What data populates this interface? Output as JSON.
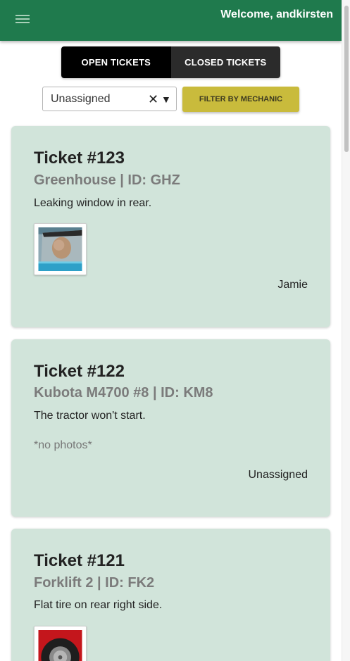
{
  "header": {
    "menu_icon": "hamburger-menu-icon",
    "welcome": "Welcome, andkirsten"
  },
  "tabs": {
    "open": "OPEN TICKETS",
    "closed": "CLOSED TICKETS",
    "active": "open"
  },
  "filter": {
    "mechanic_value": "Unassigned",
    "clear_icon": "close-icon",
    "caret_icon": "caret-down-icon",
    "button_label": "FILTER BY MECHANIC"
  },
  "tickets": [
    {
      "title": "Ticket #123",
      "subtitle": "Greenhouse | ID: GHZ",
      "description": "Leaking window in rear.",
      "photo": "broken-window-photo",
      "assignee": "Jamie"
    },
    {
      "title": "Ticket #122",
      "subtitle": "Kubota M4700 #8 | ID: KM8",
      "description": "The tractor won't start.",
      "no_photos": "*no photos*",
      "assignee": "Unassigned"
    },
    {
      "title": "Ticket #121",
      "subtitle": "Forklift 2 | ID: FK2",
      "description": "Flat tire on rear right side.",
      "photo": "flat-tire-photo"
    }
  ],
  "colors": {
    "appbar": "#1f7a4d",
    "card": "#d1e4da",
    "filter_button": "#c9bb3c",
    "tab_active": "#000000",
    "tab_inactive": "#2b2b2b"
  }
}
